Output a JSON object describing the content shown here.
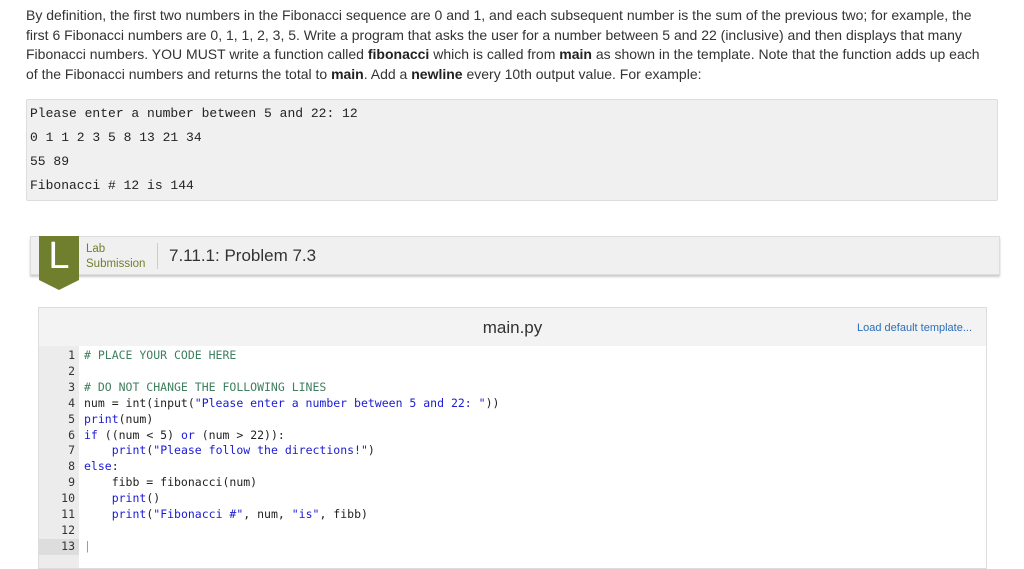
{
  "description": [
    {
      "t": "By definition, the first two numbers in the Fibonacci sequence are 0 and 1, and each subsequent number is the sum of the previous two; for example, the first 6 Fibonacci numbers are 0, 1, 1, 2, 3, 5. Write a program that asks the user for a number between 5 and 22 (inclusive) and then displays that many Fibonacci numbers. YOU MUST write a function called "
    },
    {
      "b": "fibonacci"
    },
    {
      "t": " which is called from "
    },
    {
      "b": "main"
    },
    {
      "t": " as shown in the template. Note that the function adds up each of the Fibonacci numbers and returns the total to "
    },
    {
      "b": "main"
    },
    {
      "t": ". Add a "
    },
    {
      "b": "newline"
    },
    {
      "t": " every 10th output value. For example:"
    }
  ],
  "example": [
    "Please enter a number between 5 and 22: 12",
    "0 1 1 2 3 5 8 13 21 34",
    "55 89",
    "Fibonacci # 12 is 144"
  ],
  "lab": {
    "badge": "L",
    "type_line1": "Lab",
    "type_line2": "Submission",
    "title": "7.11.1: Problem 7.3"
  },
  "editor": {
    "filename": "main.py",
    "load_default": "Load default template...",
    "lines": [
      [
        [
          "cm",
          "# PLACE YOUR CODE HERE"
        ]
      ],
      [],
      [
        [
          "cm",
          "# DO NOT CHANGE THE FOLLOWING LINES"
        ]
      ],
      [
        [
          "",
          "num = int(input("
        ],
        [
          "st",
          "\"Please enter a number between 5 and 22: \""
        ],
        [
          "",
          "))"
        ]
      ],
      [
        [
          "kw",
          "print"
        ],
        [
          "",
          "(num)"
        ]
      ],
      [
        [
          "kw",
          "if"
        ],
        [
          "",
          " ((num < 5) "
        ],
        [
          "kw",
          "or"
        ],
        [
          "",
          " (num > 22)):"
        ]
      ],
      [
        [
          "",
          "    "
        ],
        [
          "kw",
          "print"
        ],
        [
          "",
          "("
        ],
        [
          "st",
          "\"Please follow the directions!\""
        ],
        [
          "",
          ")"
        ]
      ],
      [
        [
          "kw",
          "else"
        ],
        [
          "",
          ":"
        ]
      ],
      [
        [
          "",
          "    fibb = fibonacci(num)"
        ]
      ],
      [
        [
          "",
          "    "
        ],
        [
          "kw",
          "print"
        ],
        [
          "",
          "()"
        ]
      ],
      [
        [
          "",
          "    "
        ],
        [
          "kw",
          "print"
        ],
        [
          "",
          "("
        ],
        [
          "st",
          "\"Fibonacci #\""
        ],
        [
          "",
          ", num, "
        ],
        [
          "st",
          "\"is\""
        ],
        [
          "",
          ", fibb)"
        ]
      ],
      [],
      []
    ]
  }
}
